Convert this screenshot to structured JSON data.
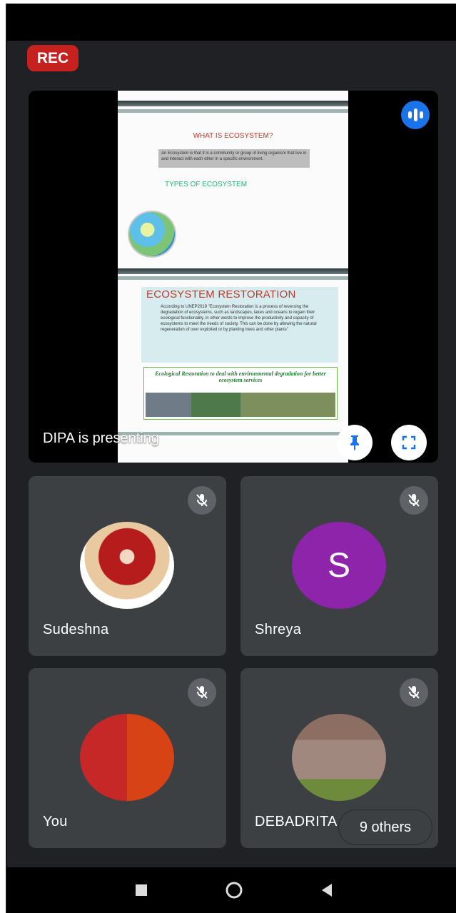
{
  "recording": {
    "label": "REC"
  },
  "presentation": {
    "presenting_text": "DIPA is presenting",
    "slide": {
      "heading1": "WHAT IS ECOSYSTEM?",
      "definition": "An Ecosystem is that it is a community or group of living organism that live in and interact with each other in a specific environment.",
      "heading2": "TYPES OF ECOSYSTEM",
      "heading3": "ECOSYSTEM RESTORATION",
      "restoration_text": "According to UNEP2019 \"Ecosystem Restoration is a process of reversing the degradation of ecosystems, such as landscapes, lakes and oceans to regain their ecological functionality. in other words to improve the productivity and capacity of ecosystems to meet the needs of society. This can be done by allowing the natural regeneration of over exploited or by planting trees and other plants\"",
      "banner": "Ecological Restoration to deal with environmental degradation for better ecosystem services"
    }
  },
  "participants": [
    {
      "name": "Sudeshna",
      "muted": true,
      "avatar": "photo"
    },
    {
      "name": "Shreya",
      "muted": true,
      "avatar_letter": "S",
      "avatar_color": "#8e24aa"
    },
    {
      "name": "You",
      "muted": true,
      "avatar": "photo"
    },
    {
      "name": "DEBADRITA",
      "muted": true,
      "avatar": "photo"
    }
  ],
  "others": {
    "label": "9 others"
  },
  "colors": {
    "background": "#202124",
    "tile": "#3c4043",
    "rec": "#c5221f",
    "accent": "#1a73e8"
  },
  "icons": [
    "audio-indicator-icon",
    "pin-icon",
    "fullscreen-icon",
    "mic-off-icon",
    "nav-recents-icon",
    "nav-home-icon",
    "nav-back-icon"
  ]
}
